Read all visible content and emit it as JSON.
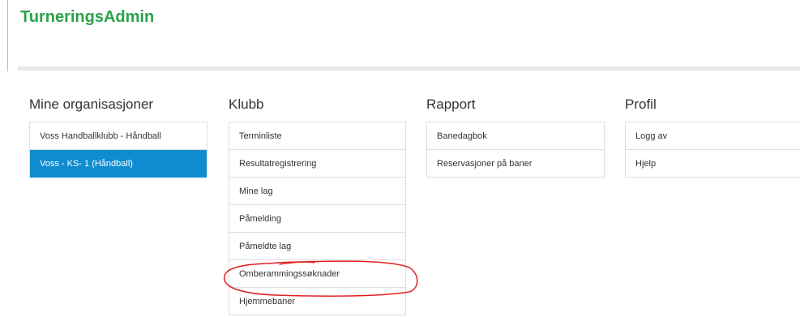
{
  "header": {
    "title": "TurneringsAdmin"
  },
  "organizations": {
    "title": "Mine organisasjoner",
    "items": [
      {
        "label": "Voss Handballklubb - Håndball"
      },
      {
        "label": "Voss - KS- 1 (Håndball)"
      }
    ]
  },
  "club": {
    "title": "Klubb",
    "items": [
      {
        "label": "Terminliste"
      },
      {
        "label": "Resultatregistrering"
      },
      {
        "label": "Mine lag"
      },
      {
        "label": "Påmelding"
      },
      {
        "label": "Påmeldte lag"
      },
      {
        "label": "Omberammingssøknader"
      },
      {
        "label": "Hjemmebaner"
      }
    ]
  },
  "report": {
    "title": "Rapport",
    "items": [
      {
        "label": "Banedagbok"
      },
      {
        "label": "Reservasjoner på baner"
      }
    ]
  },
  "profile": {
    "title": "Profil",
    "items": [
      {
        "label": "Logg av"
      },
      {
        "label": "Hjelp"
      }
    ]
  },
  "colors": {
    "brand": "#2aa24a",
    "active": "#0e8ccf",
    "annotation": "#e02020"
  }
}
